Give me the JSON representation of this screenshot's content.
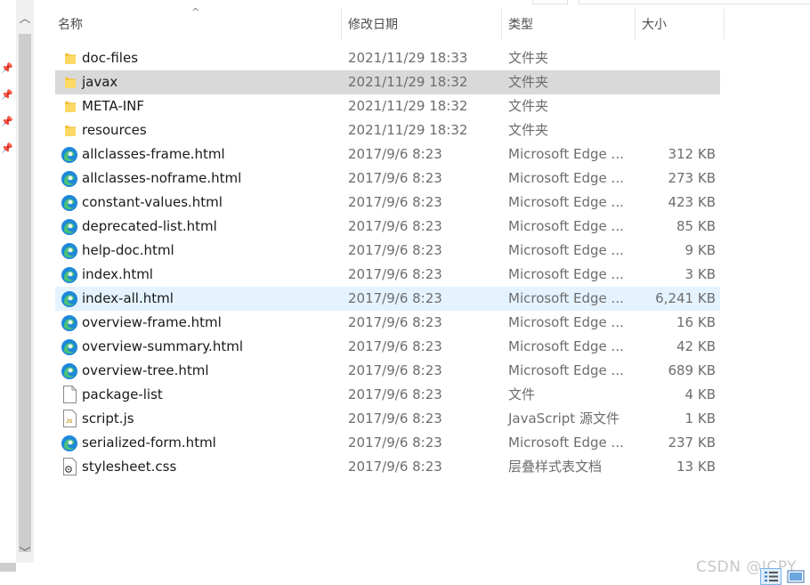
{
  "columns": {
    "name": "名称",
    "date": "修改日期",
    "type": "类型",
    "size": "大小"
  },
  "files": [
    {
      "icon": "folder",
      "name": "doc-files",
      "date": "2021/11/29 18:33",
      "type": "文件夹",
      "size": ""
    },
    {
      "icon": "folder",
      "name": "javax",
      "date": "2021/11/29 18:32",
      "type": "文件夹",
      "size": "",
      "state": "selected"
    },
    {
      "icon": "folder",
      "name": "META-INF",
      "date": "2021/11/29 18:32",
      "type": "文件夹",
      "size": ""
    },
    {
      "icon": "folder",
      "name": "resources",
      "date": "2021/11/29 18:32",
      "type": "文件夹",
      "size": ""
    },
    {
      "icon": "edge",
      "name": "allclasses-frame.html",
      "date": "2017/9/6 8:23",
      "type": "Microsoft Edge ...",
      "size": "312 KB"
    },
    {
      "icon": "edge",
      "name": "allclasses-noframe.html",
      "date": "2017/9/6 8:23",
      "type": "Microsoft Edge ...",
      "size": "273 KB"
    },
    {
      "icon": "edge",
      "name": "constant-values.html",
      "date": "2017/9/6 8:23",
      "type": "Microsoft Edge ...",
      "size": "423 KB"
    },
    {
      "icon": "edge",
      "name": "deprecated-list.html",
      "date": "2017/9/6 8:23",
      "type": "Microsoft Edge ...",
      "size": "85 KB"
    },
    {
      "icon": "edge",
      "name": "help-doc.html",
      "date": "2017/9/6 8:23",
      "type": "Microsoft Edge ...",
      "size": "9 KB"
    },
    {
      "icon": "edge",
      "name": "index.html",
      "date": "2017/9/6 8:23",
      "type": "Microsoft Edge ...",
      "size": "3 KB"
    },
    {
      "icon": "edge",
      "name": "index-all.html",
      "date": "2017/9/6 8:23",
      "type": "Microsoft Edge ...",
      "size": "6,241 KB",
      "state": "hover"
    },
    {
      "icon": "edge",
      "name": "overview-frame.html",
      "date": "2017/9/6 8:23",
      "type": "Microsoft Edge ...",
      "size": "16 KB"
    },
    {
      "icon": "edge",
      "name": "overview-summary.html",
      "date": "2017/9/6 8:23",
      "type": "Microsoft Edge ...",
      "size": "42 KB"
    },
    {
      "icon": "edge",
      "name": "overview-tree.html",
      "date": "2017/9/6 8:23",
      "type": "Microsoft Edge ...",
      "size": "689 KB"
    },
    {
      "icon": "file",
      "name": "package-list",
      "date": "2017/9/6 8:23",
      "type": "文件",
      "size": "4 KB"
    },
    {
      "icon": "js",
      "name": "script.js",
      "date": "2017/9/6 8:23",
      "type": "JavaScript 源文件",
      "size": "1 KB"
    },
    {
      "icon": "edge",
      "name": "serialized-form.html",
      "date": "2017/9/6 8:23",
      "type": "Microsoft Edge ...",
      "size": "237 KB"
    },
    {
      "icon": "css",
      "name": "stylesheet.css",
      "date": "2017/9/6 8:23",
      "type": "层叠样式表文档",
      "size": "13 KB"
    }
  ],
  "watermark": "CSDN @ICPY",
  "colors": {
    "selected": "#d9d9d9",
    "hover": "#e5f3ff",
    "folder": "#f4c542",
    "edge_blue": "#1e88d8",
    "edge_green": "#4cc07a"
  }
}
